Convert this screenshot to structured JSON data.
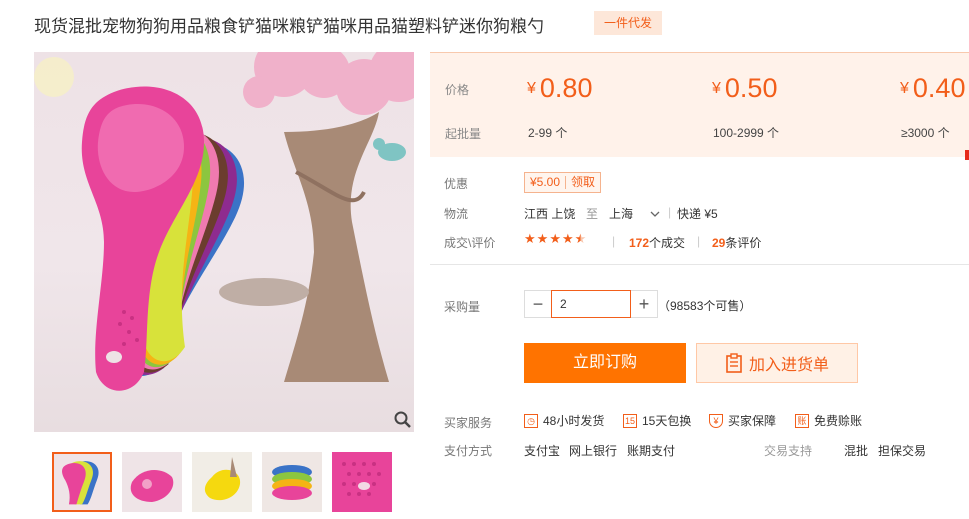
{
  "product": {
    "title": "现货混批宠物狗狗用品粮食铲猫咪粮铲猫咪用品猫塑料铲迷你狗粮勺",
    "badge": "一件代发"
  },
  "price_section": {
    "price_label": "价格",
    "moq_label": "起批量",
    "tiers": [
      {
        "currency": "¥",
        "price": "0.80",
        "range": "2-99 个"
      },
      {
        "currency": "¥",
        "price": "0.50",
        "range": "100-2999 个"
      },
      {
        "currency": "¥",
        "price": "0.40",
        "range": "≥3000 个"
      }
    ]
  },
  "discount": {
    "label": "优惠",
    "amount": "¥5.00",
    "action": "领取"
  },
  "logistics": {
    "label": "物流",
    "from": "江西 上饶",
    "to_word": "至",
    "to": "上海",
    "shipping": "快递 ¥5"
  },
  "reviews": {
    "label": "成交\\评价",
    "rating": 4.5,
    "deals_count": "172",
    "deals_text": "个成交",
    "review_count": "29",
    "review_text": "条评价"
  },
  "purchase": {
    "label": "采购量",
    "quantity": "2",
    "stock_text": "（98583个可售）",
    "minus": "−",
    "plus": "+"
  },
  "actions": {
    "buy": "立即订购",
    "cart": "加入进货单"
  },
  "services": {
    "label": "买家服务",
    "items": [
      {
        "icon": "clock-icon",
        "text": "48小时发货"
      },
      {
        "icon": "15-days-icon",
        "text": "15天包换"
      },
      {
        "icon": "shield-icon",
        "text": "买家保障"
      },
      {
        "icon": "receipt-icon",
        "text": "免费赊账"
      }
    ]
  },
  "payment": {
    "label": "支付方式",
    "methods": [
      "支付宝",
      "网上银行",
      "账期支付"
    ]
  },
  "trade_support": {
    "label": "交易支持",
    "items": [
      "混批",
      "担保交易"
    ]
  },
  "colors": {
    "accent": "#f25e1a",
    "buy_button": "#ff7300",
    "price_bg": "#fff2ea"
  }
}
